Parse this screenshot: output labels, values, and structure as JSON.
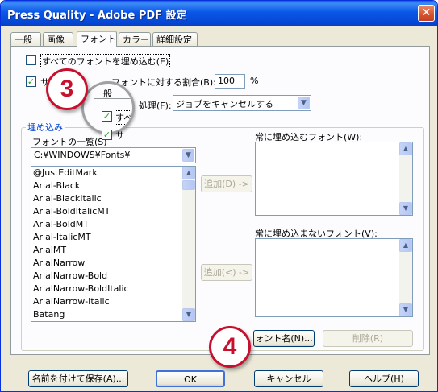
{
  "window": {
    "title": "Press Quality - Adobe PDF 設定",
    "close_glyph": "✕"
  },
  "tabs": [
    {
      "label": "一般"
    },
    {
      "label": "画像"
    },
    {
      "label": "フォント",
      "active": true
    },
    {
      "label": "カラー"
    },
    {
      "label": "詳細設定"
    }
  ],
  "embed_all": {
    "label": "すべてのフォントを埋め込む(E)",
    "checked": false
  },
  "subset": {
    "label_prefix": "サ",
    "label_suffix": "フォントに対する割合(B):",
    "checked": true,
    "value": "100",
    "unit": "%"
  },
  "fail_action": {
    "label": "処理(F):",
    "selected": "ジョブをキャンセルする"
  },
  "magnifier": {
    "label_top": "般",
    "checkbox_label": "すべ"
  },
  "embed_group": {
    "title": "埋め込み",
    "font_list_label": "フォントの一覧(S)",
    "font_path": "C:¥WINDOWS¥Fonts¥",
    "fonts": [
      "@JustEditMark",
      "Arial-Black",
      "Arial-BlackItalic",
      "Arial-BoldItalicMT",
      "Arial-BoldMT",
      "Arial-ItalicMT",
      "ArialMT",
      "ArialNarrow",
      "ArialNarrow-Bold",
      "ArialNarrow-BoldItalic",
      "ArialNarrow-Italic",
      "Batang"
    ],
    "partial_check_label": "サ",
    "add_always_label": "追加(D) ->",
    "add_never_label": "追加(<) ->",
    "always_label": "常に埋め込むフォント(W):",
    "never_label": "常に埋め込まないフォント(V):",
    "font_name_button": "ォント名(N)...",
    "remove_button": "削除(R)"
  },
  "footer": {
    "save_as": "名前を付けて保存(A)...",
    "ok": "OK",
    "cancel": "キャンセル",
    "help": "ヘルプ(H)"
  },
  "callouts": {
    "step3": "3",
    "step4": "4"
  },
  "colors": {
    "titlebar": "#0a58e8",
    "callout_red": "#c8102e",
    "group_title_blue": "#0046d5"
  }
}
